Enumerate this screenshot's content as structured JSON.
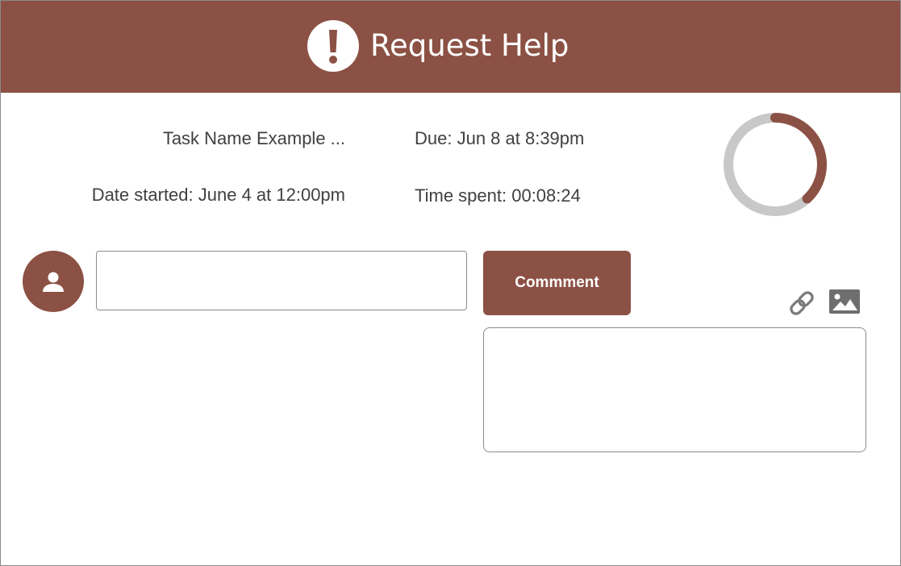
{
  "header": {
    "icon": "exclamation-icon",
    "title": "Request Help"
  },
  "task": {
    "name": "Task Name Example ...",
    "date_started": "Date started: June 4 at 12:00pm",
    "due": "Due: Jun 8 at 8:39pm",
    "time_spent": "Time spent: 00:08:24",
    "progress_fraction": 0.38
  },
  "comment": {
    "avatar_icon": "user-icon",
    "input_value": "",
    "button_label": "Commment",
    "attach_icon": "link-icon",
    "image_icon": "image-icon",
    "textarea_value": ""
  },
  "colors": {
    "brand": "#8b5144",
    "ring_track": "#c8c8c8",
    "text": "#404040",
    "border": "#8a8a8a"
  }
}
